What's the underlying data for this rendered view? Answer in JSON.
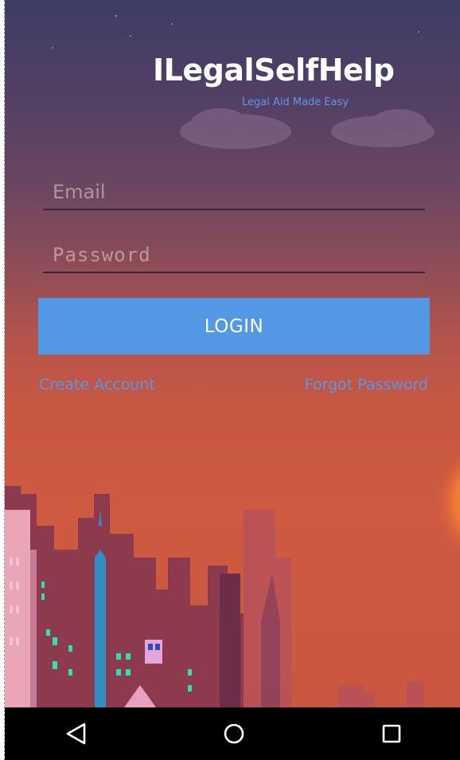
{
  "app": {
    "title": "ILegalSelfHelp",
    "subtitle": "Legal Aid Made Easy"
  },
  "form": {
    "email_placeholder": "Email",
    "email_value": "",
    "password_placeholder": "Password",
    "password_value": "",
    "login_label": "LOGIN"
  },
  "links": {
    "create_account": "Create Account",
    "forgot_password": "Forgot Password"
  },
  "navbar": {
    "back_icon": "back-triangle-icon",
    "home_icon": "home-circle-icon",
    "recents_icon": "recents-square-icon"
  },
  "colors": {
    "accent": "#5298e4",
    "link": "#5b95e6",
    "text": "#ffffff"
  }
}
